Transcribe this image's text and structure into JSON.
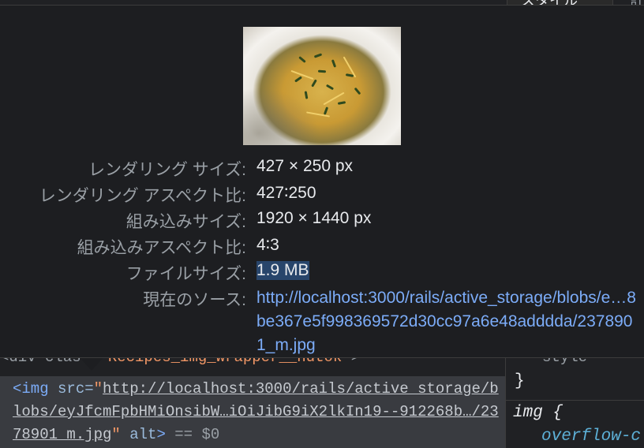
{
  "header": {
    "styles_tab": "スタイル",
    "computed_tab": "計"
  },
  "tooltip": {
    "thumbnail_alt": "noodle dish thumbnail",
    "rows": [
      {
        "label": "レンダリング サイズ:",
        "value": "427 × 250 px"
      },
      {
        "label": "レンダリング アスペクト比:",
        "value": "427∶250"
      },
      {
        "label": "組み込みサイズ:",
        "value": "1920 × 1440 px"
      },
      {
        "label": "組み込みアスペクト比:",
        "value": "4∶3"
      },
      {
        "label": "ファイルサイズ:",
        "value": "1.9 MB"
      }
    ],
    "source_label": "現在のソース:",
    "source_url": "http://localhost:3000/rails/active_storage/blobs/e…8be367e5f998369572d30cc97a6e48adddda/2378901_m.jpg"
  },
  "elements": {
    "partial_line_prefix": "<div class=",
    "partial_line_class": "\"Recipes_img_wrapper__hutok\"",
    "partial_line_suffix": ">",
    "tag_open": "<img",
    "attr_src": " src=",
    "quote": "\"",
    "src_url": "http://localhost:3000/rails/active_storage/blobs/eyJfcmFpbHMiOnsibW…iOiJibG9iX2lkIn19--912268b…/2378901_m.jpg",
    "attr_alt": " alt",
    "tag_close": ">",
    "console_ref": " == $0"
  },
  "styles": {
    "partial_text": "style",
    "close_brace": "}",
    "selector": "img {",
    "property": "overflow-c"
  }
}
